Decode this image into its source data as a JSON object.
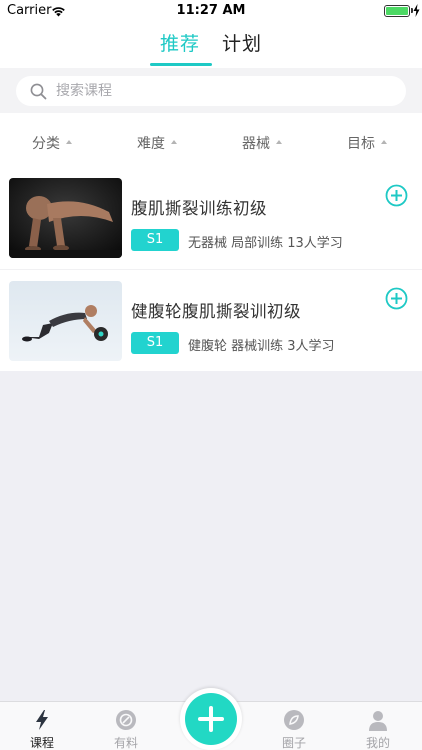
{
  "status_bar": {
    "carrier": "Carrier",
    "time": "11:27 AM",
    "battery_percent": 100
  },
  "header": {
    "tabs": [
      {
        "label": "推荐",
        "active": true
      },
      {
        "label": "计划",
        "active": false
      }
    ]
  },
  "search": {
    "placeholder": "搜索课程",
    "value": ""
  },
  "filters": [
    {
      "label": "分类"
    },
    {
      "label": "难度"
    },
    {
      "label": "器械"
    },
    {
      "label": "目标"
    }
  ],
  "courses": [
    {
      "title": "腹肌撕裂训练初级",
      "level": "S1",
      "meta": "无器械 局部训练 13人学习"
    },
    {
      "title": "健腹轮腹肌撕裂训初级",
      "level": "S1",
      "meta": "健腹轮 器械训练 3人学习"
    }
  ],
  "tabbar": {
    "items": [
      {
        "label": "课程",
        "icon": "lightning-icon",
        "active": true
      },
      {
        "label": "有料",
        "icon": "compass-circle-icon",
        "active": false
      },
      {
        "label": "",
        "icon": "plus-icon",
        "active": false
      },
      {
        "label": "圈子",
        "icon": "circle-leaf-icon",
        "active": false
      },
      {
        "label": "我的",
        "icon": "person-icon",
        "active": false
      }
    ]
  },
  "colors": {
    "accent": "#1ec9c5",
    "badge": "#22d3cf",
    "plus_button": "#22d8c4"
  }
}
